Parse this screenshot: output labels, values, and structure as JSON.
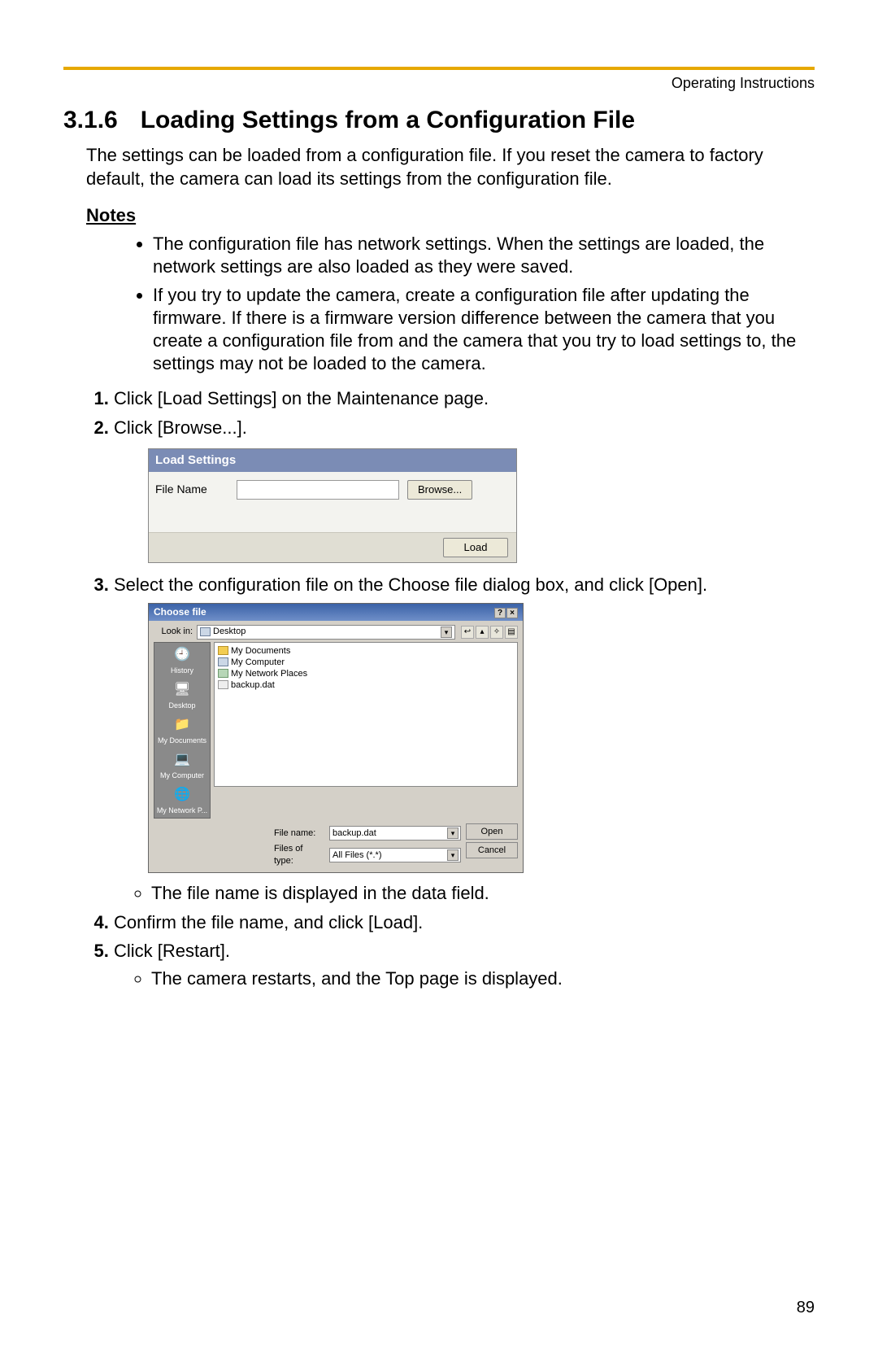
{
  "header": {
    "label": "Operating Instructions"
  },
  "section": {
    "number": "3.1.6",
    "title": "Loading Settings from a Configuration File"
  },
  "intro": "The settings can be loaded from a configuration file. If you reset the camera to factory default, the camera can load its settings from the configuration file.",
  "notes": {
    "heading": "Notes",
    "items": [
      "The configuration file has network settings. When the settings are loaded, the network settings are also loaded as they were saved.",
      "If you try to update the camera, create a configuration file after updating the firmware. If there is a firmware version difference between the camera that you create a configuration file from and the camera that you try to load settings to, the settings may not be loaded to the camera."
    ]
  },
  "steps": {
    "s1": "Click [Load Settings] on the Maintenance page.",
    "s2": "Click [Browse...].",
    "s3": "Select the configuration file on the Choose file dialog box, and click [Open].",
    "s3_sub": "The file name is displayed in the data field.",
    "s4": "Confirm the file name, and click [Load].",
    "s5": "Click [Restart].",
    "s5_sub": "The camera restarts, and the Top page is displayed."
  },
  "load_dialog": {
    "title": "Load Settings",
    "file_name_label": "File Name",
    "browse_btn": "Browse...",
    "load_btn": "Load",
    "value": ""
  },
  "choose_dialog": {
    "title": "Choose file",
    "lookin_label": "Look in:",
    "lookin_value": "Desktop",
    "places": {
      "history": "History",
      "desktop": "Desktop",
      "mydocs": "My Documents",
      "mycomp": "My Computer",
      "mynet": "My Network P..."
    },
    "items": {
      "docs": "My Documents",
      "comp": "My Computer",
      "net": "My Network Places",
      "file": "backup.dat"
    },
    "filename_label": "File name:",
    "filename_value": "backup.dat",
    "filetype_label": "Files of type:",
    "filetype_value": "All Files (*.*)",
    "open_btn": "Open",
    "cancel_btn": "Cancel"
  },
  "page_number": "89"
}
